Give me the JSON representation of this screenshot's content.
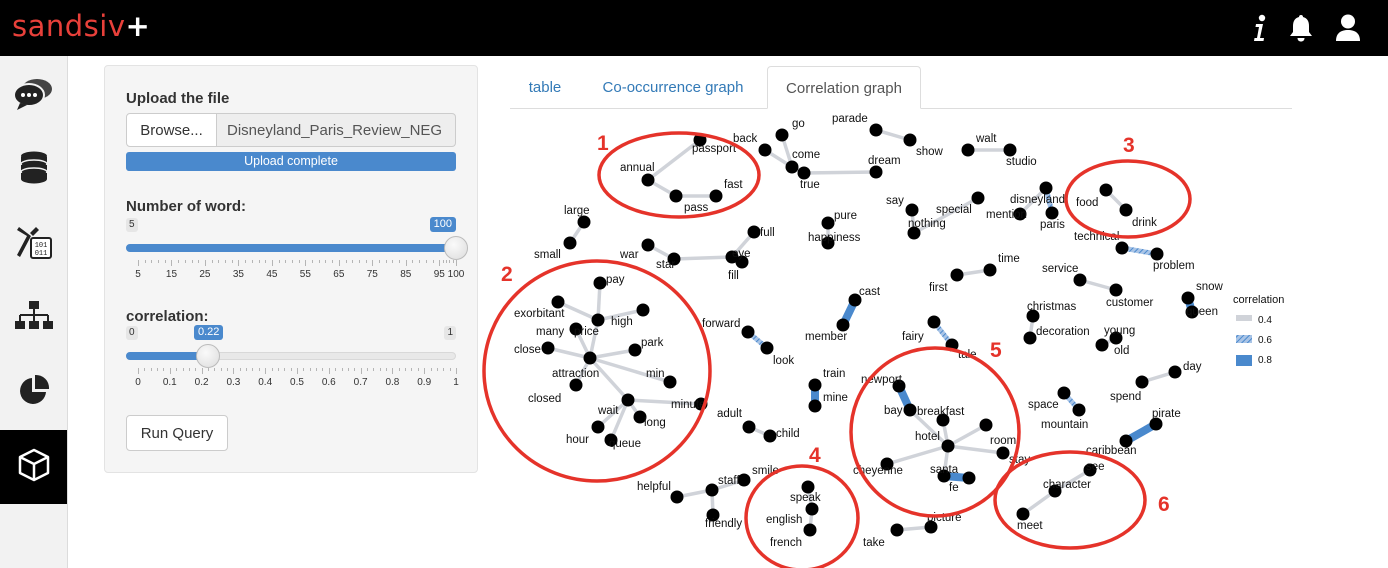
{
  "app": {
    "logo": "sandsiv",
    "logo_plus": "+"
  },
  "topbar": {
    "info_icon": "info-icon",
    "bell_icon": "bell-icon",
    "user_icon": "user-icon"
  },
  "sidebar": {
    "items": [
      {
        "icon": "chat-bubbles-icon",
        "active": false
      },
      {
        "icon": "database-icon",
        "active": false
      },
      {
        "icon": "binary-tool-icon",
        "active": false
      },
      {
        "icon": "hierarchy-icon",
        "active": false
      },
      {
        "icon": "pie-chart-icon",
        "active": false
      },
      {
        "icon": "cube-icon",
        "active": true
      }
    ]
  },
  "controls": {
    "upload_label": "Upload the file",
    "browse_label": "Browse...",
    "file_name": "Disneyland_Paris_Review_NEG",
    "upload_status": "Upload complete",
    "words_label": "Number of word:",
    "words_slider": {
      "min": 5,
      "max": 100,
      "value": 100,
      "ticks": [
        "5",
        "15",
        "25",
        "35",
        "45",
        "55",
        "65",
        "75",
        "85",
        "95",
        "100"
      ]
    },
    "corr_label": "correlation:",
    "corr_slider": {
      "min": 0,
      "max": 1,
      "value": 0.22,
      "ticks": [
        "0",
        "0.1",
        "0.2",
        "0.3",
        "0.4",
        "0.5",
        "0.6",
        "0.7",
        "0.8",
        "0.9",
        "1"
      ]
    },
    "run_label": "Run Query"
  },
  "tabs": [
    {
      "label": "table",
      "active": false
    },
    {
      "label": "Co-occurrence graph",
      "active": false
    },
    {
      "label": "Correlation graph",
      "active": true
    }
  ],
  "legend": {
    "title": "correlation",
    "items": [
      "0.4",
      "0.6",
      "0.8"
    ]
  },
  "annotations": [
    "1",
    "2",
    "3",
    "4",
    "5",
    "6"
  ],
  "colors": {
    "accent": "#4a89cd",
    "logo_red": "#e8403a",
    "annotation_red": "#e5332a"
  },
  "graph": {
    "nodes": [
      {
        "id": "passport",
        "label": "passport"
      },
      {
        "id": "annual",
        "label": "annual"
      },
      {
        "id": "fast",
        "label": "fast"
      },
      {
        "id": "pass",
        "label": "pass"
      },
      {
        "id": "back",
        "label": "back"
      },
      {
        "id": "go",
        "label": "go"
      },
      {
        "id": "come",
        "label": "come"
      },
      {
        "id": "true",
        "label": "true"
      },
      {
        "id": "parade",
        "label": "parade"
      },
      {
        "id": "show",
        "label": "show"
      },
      {
        "id": "dream",
        "label": "dream"
      },
      {
        "id": "walt",
        "label": "walt"
      },
      {
        "id": "studio",
        "label": "studio"
      },
      {
        "id": "disneyland",
        "label": "disneyland"
      },
      {
        "id": "mention",
        "label": "mention"
      },
      {
        "id": "paris",
        "label": "paris"
      },
      {
        "id": "food",
        "label": "food"
      },
      {
        "id": "drink",
        "label": "drink"
      },
      {
        "id": "large",
        "label": "large"
      },
      {
        "id": "small",
        "label": "small"
      },
      {
        "id": "say",
        "label": "say"
      },
      {
        "id": "nothing",
        "label": "nothing"
      },
      {
        "id": "special",
        "label": "special"
      },
      {
        "id": "pure",
        "label": "pure"
      },
      {
        "id": "happiness",
        "label": "happiness"
      },
      {
        "id": "full",
        "label": "full"
      },
      {
        "id": "eye",
        "label": "eye"
      },
      {
        "id": "fill",
        "label": "fill"
      },
      {
        "id": "war",
        "label": "war"
      },
      {
        "id": "star",
        "label": "star"
      },
      {
        "id": "technical",
        "label": "technical"
      },
      {
        "id": "problem",
        "label": "problem"
      },
      {
        "id": "time",
        "label": "time"
      },
      {
        "id": "first",
        "label": "first"
      },
      {
        "id": "service",
        "label": "service"
      },
      {
        "id": "customer",
        "label": "customer"
      },
      {
        "id": "snow",
        "label": "snow"
      },
      {
        "id": "queen",
        "label": "queen"
      },
      {
        "id": "pay",
        "label": "pay"
      },
      {
        "id": "exorbitant",
        "label": "exorbitant"
      },
      {
        "id": "high",
        "label": "high"
      },
      {
        "id": "many",
        "label": "many"
      },
      {
        "id": "price",
        "label": "price"
      },
      {
        "id": "park",
        "label": "park"
      },
      {
        "id": "close",
        "label": "close"
      },
      {
        "id": "attraction",
        "label": "attraction"
      },
      {
        "id": "min",
        "label": "min"
      },
      {
        "id": "closed",
        "label": "closed"
      },
      {
        "id": "minute",
        "label": "minute"
      },
      {
        "id": "wait",
        "label": "wait"
      },
      {
        "id": "long",
        "label": "long"
      },
      {
        "id": "hour",
        "label": "hour"
      },
      {
        "id": "queue",
        "label": "queue"
      },
      {
        "id": "cast",
        "label": "cast"
      },
      {
        "id": "member",
        "label": "member"
      },
      {
        "id": "forward",
        "label": "forward"
      },
      {
        "id": "look",
        "label": "look"
      },
      {
        "id": "christmas",
        "label": "christmas"
      },
      {
        "id": "decoration",
        "label": "decoration"
      },
      {
        "id": "young",
        "label": "young"
      },
      {
        "id": "old",
        "label": "old"
      },
      {
        "id": "fairy",
        "label": "fairy"
      },
      {
        "id": "tale",
        "label": "tale"
      },
      {
        "id": "train",
        "label": "train"
      },
      {
        "id": "mine",
        "label": "mine"
      },
      {
        "id": "newport",
        "label": "newport"
      },
      {
        "id": "bay",
        "label": "bay"
      },
      {
        "id": "breakfast",
        "label": "breakfast"
      },
      {
        "id": "hotel",
        "label": "hotel"
      },
      {
        "id": "room",
        "label": "room"
      },
      {
        "id": "stay",
        "label": "stay"
      },
      {
        "id": "cheyenne",
        "label": "cheyenne"
      },
      {
        "id": "santa",
        "label": "santa"
      },
      {
        "id": "fe",
        "label": "fe"
      },
      {
        "id": "day",
        "label": "day"
      },
      {
        "id": "spend",
        "label": "spend"
      },
      {
        "id": "space",
        "label": "space"
      },
      {
        "id": "mountain",
        "label": "mountain"
      },
      {
        "id": "pirate",
        "label": "pirate"
      },
      {
        "id": "caribbean",
        "label": "caribbean"
      },
      {
        "id": "adult",
        "label": "adult"
      },
      {
        "id": "child",
        "label": "child"
      },
      {
        "id": "smile",
        "label": "smile"
      },
      {
        "id": "staff",
        "label": "staff"
      },
      {
        "id": "helpful",
        "label": "helpful"
      },
      {
        "id": "friendly",
        "label": "friendly"
      },
      {
        "id": "speak",
        "label": "speak"
      },
      {
        "id": "english",
        "label": "english"
      },
      {
        "id": "french",
        "label": "french"
      },
      {
        "id": "picture",
        "label": "picture"
      },
      {
        "id": "take",
        "label": "take"
      },
      {
        "id": "see",
        "label": "see"
      },
      {
        "id": "character",
        "label": "character"
      },
      {
        "id": "meet",
        "label": "meet"
      }
    ],
    "edges": [
      {
        "source": "annual",
        "target": "passport",
        "correlation": 0.3
      },
      {
        "source": "annual",
        "target": "pass",
        "correlation": 0.3
      },
      {
        "source": "pass",
        "target": "fast",
        "correlation": 0.5
      },
      {
        "source": "back",
        "target": "come",
        "correlation": 0.3
      },
      {
        "source": "go",
        "target": "come",
        "correlation": 0.3
      },
      {
        "source": "come",
        "target": "true",
        "correlation": 0.3
      },
      {
        "source": "true",
        "target": "dream",
        "correlation": 0.4
      },
      {
        "source": "parade",
        "target": "show",
        "correlation": 0.3
      },
      {
        "source": "walt",
        "target": "studio",
        "correlation": 0.4
      },
      {
        "source": "disneyland",
        "target": "mention",
        "correlation": 0.3
      },
      {
        "source": "disneyland",
        "target": "paris",
        "correlation": 0.7
      },
      {
        "source": "food",
        "target": "drink",
        "correlation": 0.4
      },
      {
        "source": "large",
        "target": "small",
        "correlation": 0.3
      },
      {
        "source": "say",
        "target": "nothing",
        "correlation": 0.3
      },
      {
        "source": "special",
        "target": "nothing",
        "correlation": 0.3
      },
      {
        "source": "pure",
        "target": "happiness",
        "correlation": 0.3
      },
      {
        "source": "war",
        "target": "star",
        "correlation": 0.4
      },
      {
        "source": "star",
        "target": "eye",
        "correlation": 0.4
      },
      {
        "source": "full",
        "target": "eye",
        "correlation": 0.3
      },
      {
        "source": "eye",
        "target": "fill",
        "correlation": 0.3
      },
      {
        "source": "technical",
        "target": "problem",
        "correlation": 0.7
      },
      {
        "source": "first",
        "target": "time",
        "correlation": 0.3
      },
      {
        "source": "service",
        "target": "customer",
        "correlation": 0.4
      },
      {
        "source": "snow",
        "target": "queen",
        "correlation": 0.8
      },
      {
        "source": "pay",
        "target": "price",
        "correlation": 0.3
      },
      {
        "source": "exorbitant",
        "target": "price",
        "correlation": 0.3
      },
      {
        "source": "high",
        "target": "price",
        "correlation": 0.3
      },
      {
        "source": "many",
        "target": "attraction",
        "correlation": 0.3
      },
      {
        "source": "price",
        "target": "attraction",
        "correlation": 0.3
      },
      {
        "source": "close",
        "target": "attraction",
        "correlation": 0.4
      },
      {
        "source": "park",
        "target": "attraction",
        "correlation": 0.3
      },
      {
        "source": "attraction",
        "target": "min",
        "correlation": 0.3
      },
      {
        "source": "attraction",
        "target": "closed",
        "correlation": 0.3
      },
      {
        "source": "attraction",
        "target": "wait",
        "correlation": 0.3
      },
      {
        "source": "wait",
        "target": "minute",
        "correlation": 0.3
      },
      {
        "source": "wait",
        "target": "long",
        "correlation": 0.3
      },
      {
        "source": "wait",
        "target": "queue",
        "correlation": 0.3
      },
      {
        "source": "wait",
        "target": "hour",
        "correlation": 0.3
      },
      {
        "source": "cast",
        "target": "member",
        "correlation": 0.8
      },
      {
        "source": "forward",
        "target": "look",
        "correlation": 0.7
      },
      {
        "source": "young",
        "target": "old",
        "correlation": 0.4
      },
      {
        "source": "christmas",
        "target": "decoration",
        "correlation": 0.3
      },
      {
        "source": "fairy",
        "target": "tale",
        "correlation": 0.7
      },
      {
        "source": "train",
        "target": "mine",
        "correlation": 0.8
      },
      {
        "source": "newport",
        "target": "bay",
        "correlation": 0.8
      },
      {
        "source": "breakfast",
        "target": "hotel",
        "correlation": 0.3
      },
      {
        "source": "hotel",
        "target": "room",
        "correlation": 0.3
      },
      {
        "source": "hotel",
        "target": "stay",
        "correlation": 0.4
      },
      {
        "source": "hotel",
        "target": "cheyenne",
        "correlation": 0.3
      },
      {
        "source": "hotel",
        "target": "santa",
        "correlation": 0.3
      },
      {
        "source": "hotel",
        "target": "bay",
        "correlation": 0.3
      },
      {
        "source": "santa",
        "target": "fe",
        "correlation": 0.8
      },
      {
        "source": "spend",
        "target": "day",
        "correlation": 0.3
      },
      {
        "source": "space",
        "target": "mountain",
        "correlation": 0.7
      },
      {
        "source": "pirate",
        "target": "caribbean",
        "correlation": 0.8
      },
      {
        "source": "adult",
        "target": "child",
        "correlation": 0.3
      },
      {
        "source": "smile",
        "target": "staff",
        "correlation": 0.3
      },
      {
        "source": "staff",
        "target": "helpful",
        "correlation": 0.3
      },
      {
        "source": "staff",
        "target": "friendly",
        "correlation": 0.3
      },
      {
        "source": "speak",
        "target": "english",
        "correlation": 0.4
      },
      {
        "source": "english",
        "target": "french",
        "correlation": 0.4
      },
      {
        "source": "take",
        "target": "picture",
        "correlation": 0.3
      },
      {
        "source": "see",
        "target": "character",
        "correlation": 0.3
      },
      {
        "source": "character",
        "target": "meet",
        "correlation": 0.3
      }
    ]
  }
}
